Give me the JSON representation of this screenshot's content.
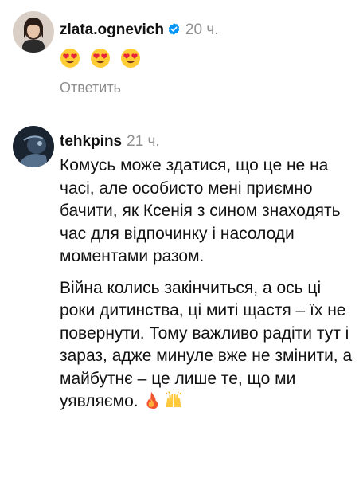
{
  "comments": [
    {
      "username": "zlata.ognevich",
      "verified": true,
      "time": "20 ч.",
      "emojis": [
        "heart-eyes-emoji",
        "heart-eyes-emoji",
        "heart-eyes-emoji"
      ],
      "reply_label": "Ответить"
    },
    {
      "username": "tehkpins",
      "verified": false,
      "time": "21 ч.",
      "paragraphs": [
        "Комусь може здатися, що це не на часі, але особисто мені приємно бачити, як Ксенія з сином знаходять час для відпочинку і насолоди моментами разом.",
        "Війна колись закінчиться, а ось ці роки дитинства, ці миті щастя – їх не повернути. Тому важливо радіти тут і зараз, адже минуле вже не змінити, а майбутнє – це лише те, що ми уявляємо."
      ],
      "trailing_emojis": [
        "fire-emoji",
        "raising-hands-emoji"
      ]
    }
  ],
  "colors": {
    "text": "#111111",
    "muted": "#8e8e8e",
    "verified_badge": "#0095f6"
  }
}
